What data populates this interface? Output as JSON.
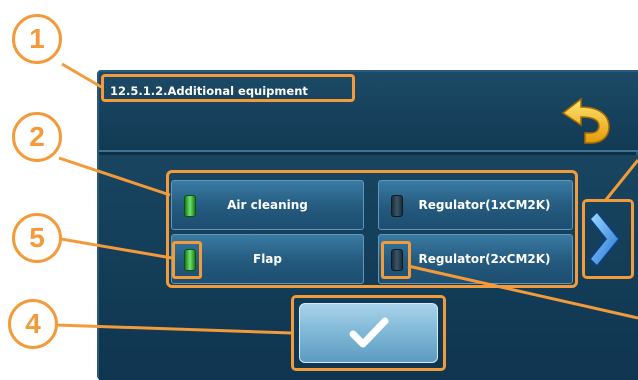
{
  "header": {
    "title": "12.5.1.2.Additional equipment",
    "back_icon": "back-arrow-icon"
  },
  "options": [
    {
      "label": "Air cleaning",
      "state": "on"
    },
    {
      "label": "Regulator(1xCM2K)",
      "state": "off"
    },
    {
      "label": "Flap",
      "state": "on"
    },
    {
      "label": "Regulator(2xCM2K)",
      "state": "off"
    }
  ],
  "navigation": {
    "next_icon": "chevron-right-icon"
  },
  "confirm": {
    "icon": "checkmark-icon"
  },
  "callouts": [
    "1",
    "2",
    "5",
    "4"
  ],
  "colors": {
    "callout": "#f39a3a",
    "background": "#0e2f44",
    "button": "#245a7e",
    "led_on": "#6ee46e",
    "back_arrow": "#f7c21a"
  }
}
